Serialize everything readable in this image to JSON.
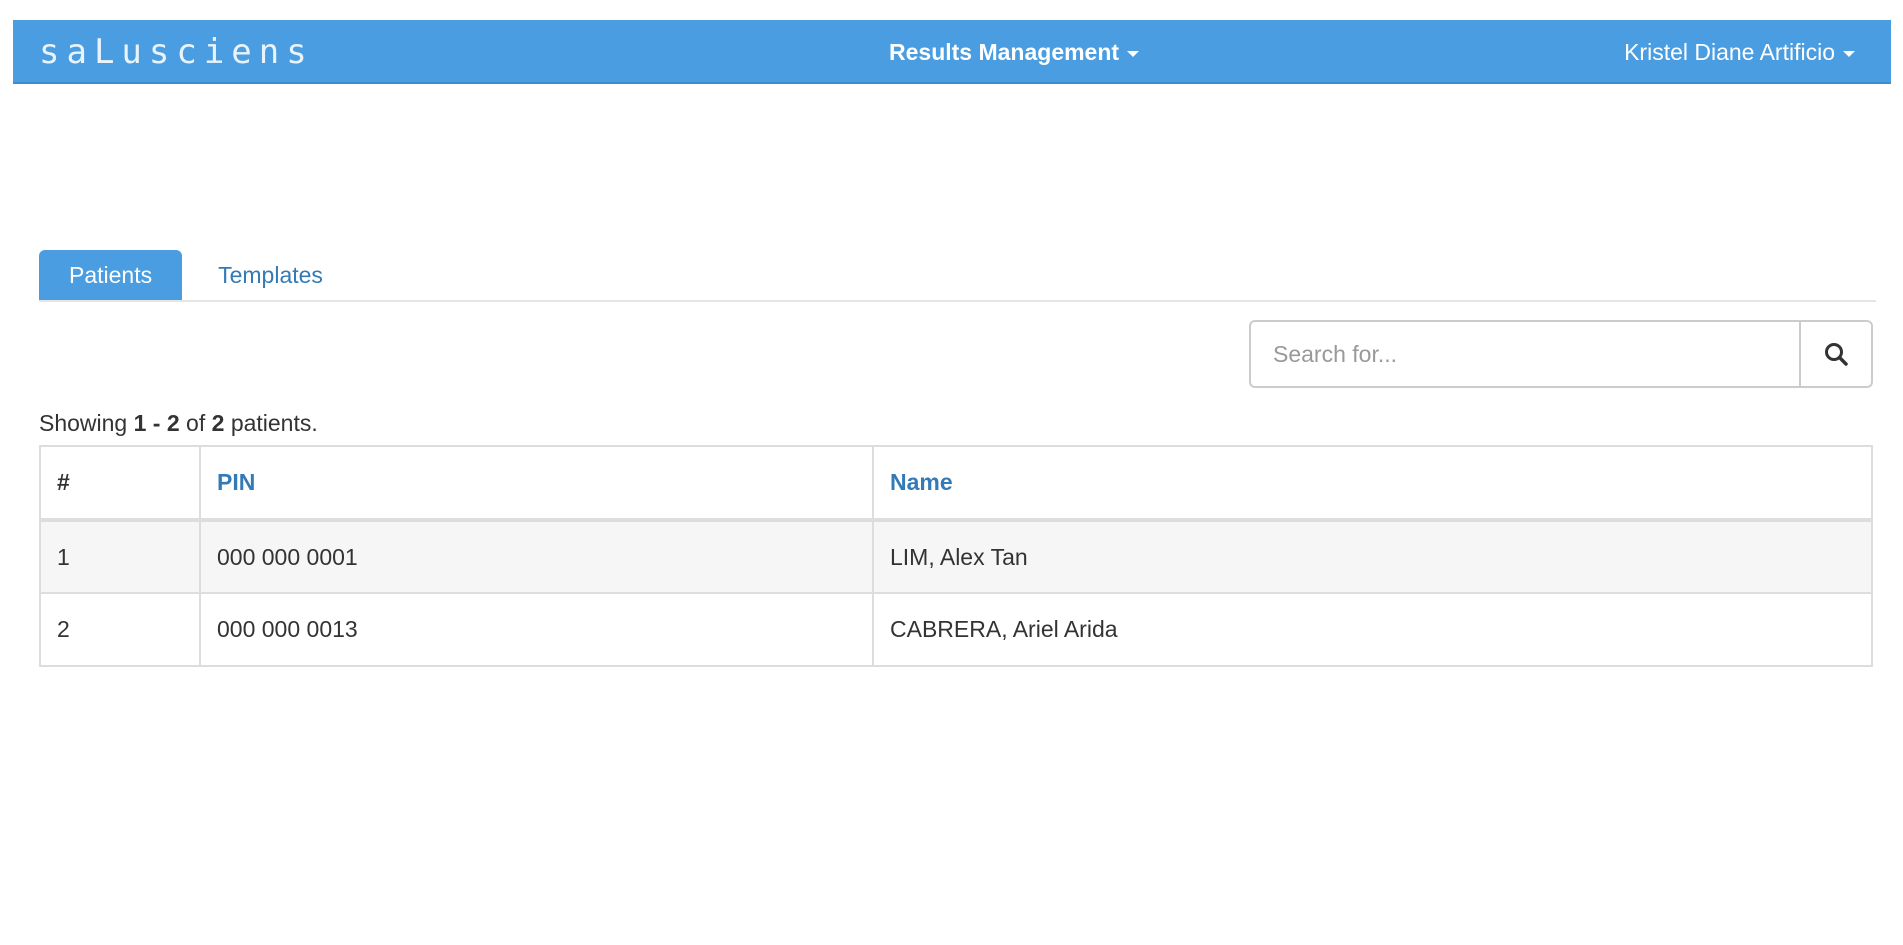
{
  "navbar": {
    "brand": "saLusciens",
    "menu_label": "Results Management",
    "user_label": "Kristel Diane Artificio"
  },
  "tabs": [
    {
      "label": "Patients",
      "active": true
    },
    {
      "label": "Templates",
      "active": false
    }
  ],
  "search": {
    "placeholder": "Search for...",
    "value": "",
    "button_icon": "search-icon"
  },
  "summary": {
    "prefix": "Showing",
    "range": "1 - 2",
    "of": "of",
    "total": "2",
    "suffix": "patients."
  },
  "table": {
    "columns": [
      "#",
      "PIN",
      "Name"
    ],
    "rows": [
      {
        "num": "1",
        "pin": "000 000 0001",
        "name": "LIM, Alex Tan"
      },
      {
        "num": "2",
        "pin": "000 000 0013",
        "name": "CABRERA, Ariel Arida"
      }
    ]
  },
  "colors": {
    "navbar": "#4a9de0",
    "link": "#337ab7"
  }
}
